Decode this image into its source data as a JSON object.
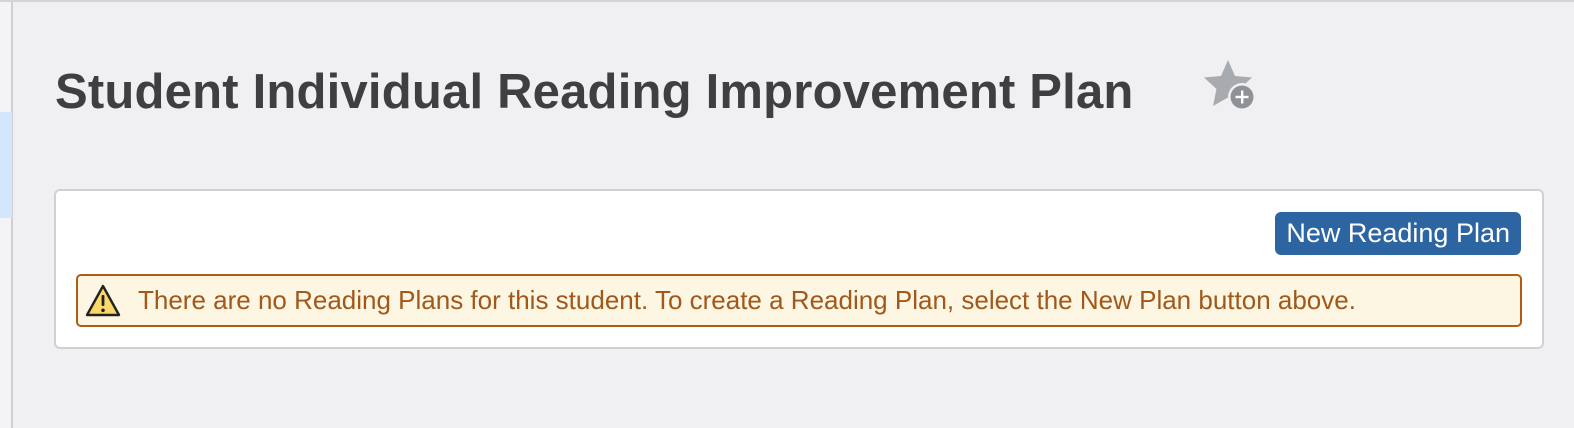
{
  "header": {
    "title": "Student Individual Reading Improvement Plan",
    "favorite_icon": "star-add-icon"
  },
  "panel": {
    "new_plan_button_label": "New Reading Plan",
    "alert": {
      "icon": "warning-icon",
      "message": "There are no Reading Plans for this student. To create a Reading Plan, select the New Plan button above."
    }
  },
  "colors": {
    "primary_button": "#2d65a3",
    "alert_background": "#fcf6e2",
    "alert_border": "#b05c16",
    "alert_text": "#a1581a",
    "title_text": "#3f3f42",
    "page_background": "#f0f0f2"
  }
}
